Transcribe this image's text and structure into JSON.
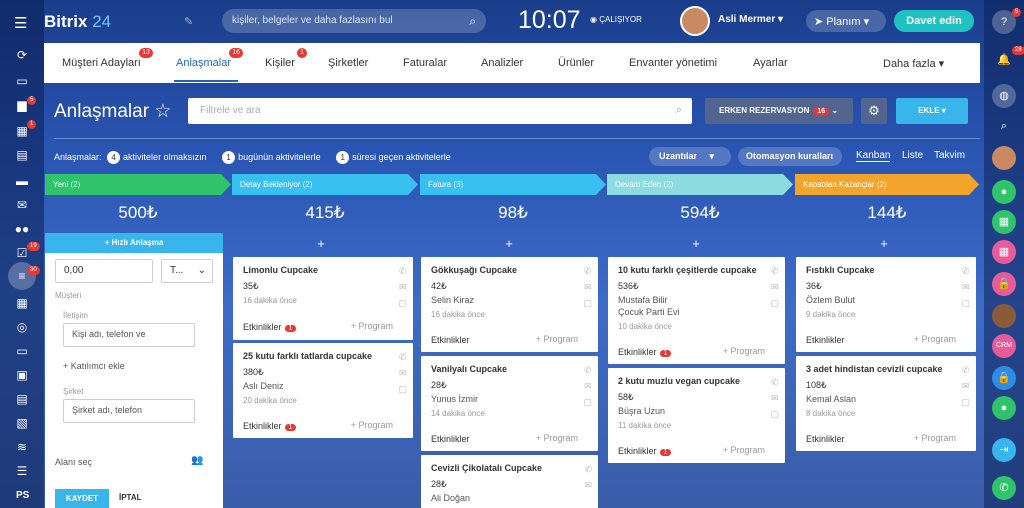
{
  "app": {
    "name": "Bitrix",
    "version": "24"
  },
  "search": {
    "placeholder": "kişiler, belgeler ve daha fazlasını bul"
  },
  "clock": {
    "time": "10:07",
    "status": "ÇALIŞIYOR"
  },
  "user": {
    "name": "Asli Mermer"
  },
  "planim": "Planım",
  "invite": "Davet edin",
  "left_badges": [
    "5",
    "1",
    "19",
    "30"
  ],
  "right_badges": [
    "5",
    "28"
  ],
  "right_chat": "CRM",
  "nav": {
    "tabs": [
      {
        "label": "Müşteri Adayları",
        "badge": "13"
      },
      {
        "label": "Anlaşmalar",
        "badge": "16"
      },
      {
        "label": "Kişiler",
        "badge": "1"
      },
      {
        "label": "Şirketler",
        "badge": ""
      },
      {
        "label": "Faturalar",
        "badge": ""
      },
      {
        "label": "Analizler",
        "badge": ""
      },
      {
        "label": "Ürünler",
        "badge": ""
      },
      {
        "label": "Envanter yönetimi",
        "badge": ""
      },
      {
        "label": "Ayarlar",
        "badge": ""
      },
      {
        "label": "Daha fazla",
        "badge": ""
      }
    ]
  },
  "page": {
    "title": "Anlaşmalar",
    "filter_placeholder": "Filtrele ve ara",
    "erken": "ERKEN REZERVASYON",
    "erken_badge": "16",
    "add": "EKLE"
  },
  "counters": {
    "label": "Anlaşmalar:",
    "items": [
      {
        "count": "4",
        "text": "aktiviteler olmaksızın"
      },
      {
        "count": "1",
        "text": "bugünün aktivitelerle"
      },
      {
        "count": "1",
        "text": "süresi geçen aktivitelerle"
      }
    ]
  },
  "toolbar": {
    "extensions": "Uzantılar",
    "automation": "Otomasyon kuralları"
  },
  "views": [
    "Kanban",
    "Liste",
    "Takvim"
  ],
  "columns": [
    {
      "name": "Yeni",
      "count": "(2)",
      "sum": "500₺",
      "color": "#2fc36a"
    },
    {
      "name": "Detay Bekleniyor",
      "count": "(2)",
      "sum": "415₺",
      "color": "#37c0f0"
    },
    {
      "name": "Fatura",
      "count": "(3)",
      "sum": "98₺",
      "color": "#37c0f0"
    },
    {
      "name": "Devam Eden",
      "count": "(2)",
      "sum": "594₺",
      "color": "#8bdbe0"
    },
    {
      "name": "Kapatılan Kazançlar",
      "count": "(2)",
      "sum": "144₺",
      "color": "#f3a52b"
    }
  ],
  "quick_form": {
    "button": "+ Hızlı Anlaşma",
    "amount": "0,00",
    "currency": "T...",
    "client_label": "Müşteri",
    "contact_label": "İletişim",
    "contact_placeholder": "Kişi adı, telefon ve",
    "add_participant": "+ Katılımcı ekle",
    "company_label": "Şirket",
    "company_placeholder": "Şirket adı, telefon",
    "select_fields": "Alanı seç",
    "save": "KAYDET",
    "cancel": "İPTAL"
  },
  "cards": {
    "col2": [
      {
        "title": "Limonlu Cupcake",
        "value": "35₺",
        "person": "",
        "time": "16 dakika önce",
        "activities": "Etkinlikler",
        "badge": "1",
        "program": "+ Program"
      },
      {
        "title": "25 kutu farklı tatlarda cupcake",
        "value": "380₺",
        "person": "Aslı Deniz",
        "time": "20 dakika önce",
        "activities": "Etkinlikler",
        "badge": "1",
        "program": "+ Program"
      }
    ],
    "col3": [
      {
        "title": "Gökkuşağı Cupcake",
        "value": "42₺",
        "person": "Selin Kiraz",
        "time": "16 dakika önce",
        "activities": "Etkinlikler",
        "badge": "",
        "program": "+ Program"
      },
      {
        "title": "Vanilyalı Cupcake",
        "value": "28₺",
        "person": "Yunus İzmir",
        "time": "14 dakika önce",
        "activities": "Etkinlikler",
        "badge": "",
        "program": "+ Program"
      },
      {
        "title": "Cevizli Çikolatalı Cupcake",
        "value": "28₺",
        "person": "Ali Doğan",
        "time": "",
        "activities": "",
        "badge": "",
        "program": ""
      }
    ],
    "col4": [
      {
        "title": "10 kutu farklı çeşitlerde cupcake",
        "value": "536₺",
        "person": "Mustafa Bilir",
        "person2": "Çocuk Parti Evi",
        "time": "10 dakika önce",
        "activities": "Etkinlikler",
        "badge": "1",
        "program": "+ Program"
      },
      {
        "title": "2 kutu muzlu vegan cupcake",
        "value": "58₺",
        "person": "Büşra Uzun",
        "time": "11 dakika önce",
        "activities": "Etkinlikler",
        "badge": "1",
        "program": "+ Program"
      }
    ],
    "col5": [
      {
        "title": "Fıstıklı Cupcake",
        "value": "36₺",
        "person": "Özlem Bulut",
        "time": "9 dakika önce",
        "activities": "Etkinlikler",
        "badge": "",
        "program": "+ Program"
      },
      {
        "title": "3 adet hindistan cevizli cupcake",
        "value": "108₺",
        "person": "Kemal Aslan",
        "time": "8 dakika önce",
        "activities": "Etkinlikler",
        "badge": "",
        "program": "+ Program"
      }
    ]
  }
}
